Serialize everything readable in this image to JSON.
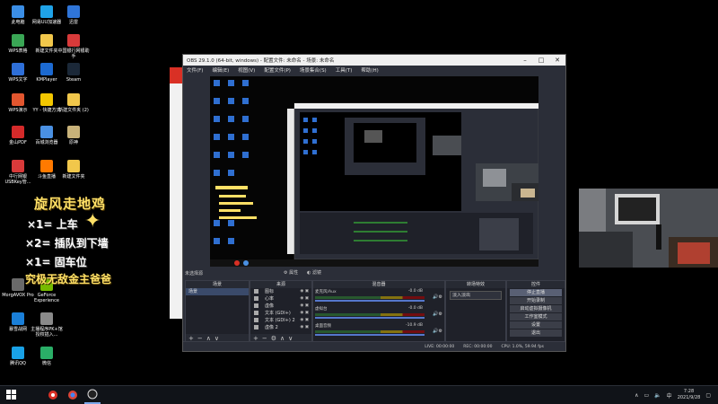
{
  "desktop": {
    "icons": [
      {
        "label": "此电脑",
        "color": "#3b8ee6"
      },
      {
        "label": "网易UU加速器",
        "color": "#1fa3e8"
      },
      {
        "label": "迅雷",
        "color": "#2f75d8"
      },
      {
        "label": "WPS表格",
        "color": "#3aa655"
      },
      {
        "label": "新建文件夹",
        "color": "#f1c74b"
      },
      {
        "label": "中国银行网银助手",
        "color": "#d83a3a"
      },
      {
        "label": "WPS文字",
        "color": "#2e6fd8"
      },
      {
        "label": "KMPlayer",
        "color": "#1c6ad1"
      },
      {
        "label": "Steam",
        "color": "#1b2838"
      },
      {
        "label": "WPS演示",
        "color": "#e2562f"
      },
      {
        "label": "YY - 快捷方式",
        "color": "#f3c700"
      },
      {
        "label": "新建文件夹 (2)",
        "color": "#f1c74b"
      },
      {
        "label": "金山PDF",
        "color": "#d42a2a"
      },
      {
        "label": "百城浏览器",
        "color": "#4a90e2"
      },
      {
        "label": "原神",
        "color": "#c8b27a"
      },
      {
        "label": "中行网银USBKey管...",
        "color": "#d83a3a"
      },
      {
        "label": "斗鱼直播",
        "color": "#ff7a00"
      },
      {
        "label": "新建文件夹",
        "color": "#f1c74b"
      },
      {
        "label": "MorgAVOX Pro",
        "color": "#6a6a6a"
      },
      {
        "label": "GeForce Experience",
        "color": "#76b900"
      },
      {
        "label": "暴雪战网",
        "color": "#1a7fd8"
      },
      {
        "label": "主播程序PK+馆授权插入...",
        "color": "#8a8a8a"
      },
      {
        "label": "腾讯QQ",
        "color": "#19a1e6"
      },
      {
        "label": "微信",
        "color": "#2aae67"
      }
    ]
  },
  "overlay": {
    "title": "旋风走地鸡",
    "line1": "×1= 上车",
    "line2": "×2= 插队到下墙",
    "line3": "×1= 固车位",
    "line4": "究极无敌金主爸爸"
  },
  "obs": {
    "window_title": "OBS 29.1.0 (64-bit, windows) - 配置文件: 未命名 - 场景: 未命名",
    "menu": [
      "文件(F)",
      "编辑(E)",
      "视图(V)",
      "配置文件(P)",
      "场景集合(S)",
      "工具(T)",
      "帮助(H)"
    ],
    "scene_label": "未选择源",
    "toolbar_props": "属性",
    "toolbar_filters": "滤镜",
    "panels": {
      "scenes": {
        "title": "场景",
        "items": [
          "场景"
        ]
      },
      "sources": {
        "title": "来源",
        "items": [
          "图标",
          "心率",
          "虚像",
          "文本 (GDI+)",
          "文本 (GDI+) 2",
          "虚像 2"
        ]
      },
      "mixer": {
        "title": "混音器",
        "items": [
          {
            "name": "麦克风/Aux",
            "db": "-0.0 dB"
          },
          {
            "name": "虚拟台",
            "db": "-0.0 dB"
          },
          {
            "name": "桌面音频",
            "db": "-10.9 dB"
          }
        ]
      },
      "transitions": {
        "title": "转场特效",
        "value": "淡入淡出"
      },
      "controls": {
        "title": "控件",
        "buttons": [
          "停止直播",
          "开始录制",
          "启动虚拟摄像机",
          "工作室模式",
          "设置",
          "退出"
        ]
      }
    },
    "status": {
      "live": "LIVE: 00:00:00",
      "rec": "REC: 00:00:00",
      "cpu": "CPU: 1.0%, 59.94 fps"
    }
  },
  "taskbar": {
    "time": "7:28",
    "date": "2021/9/28",
    "ime": "中"
  }
}
